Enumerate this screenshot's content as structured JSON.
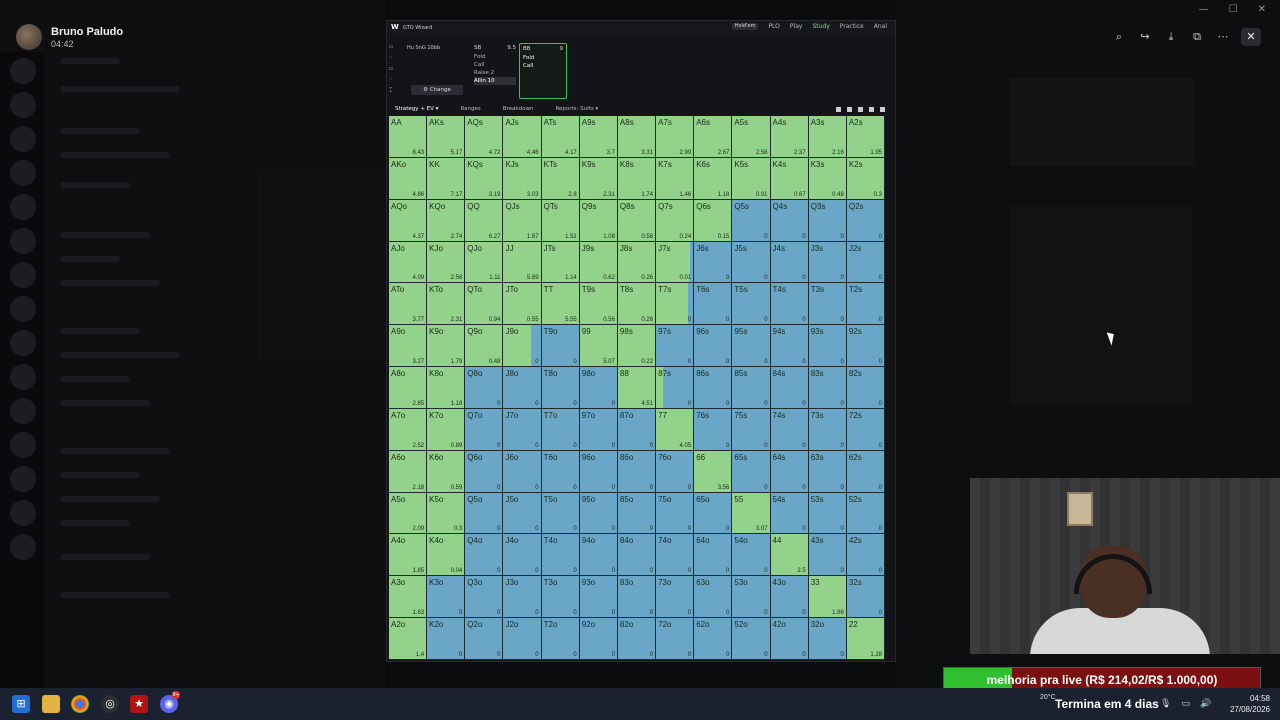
{
  "header": {
    "user_name": "Bruno Paludo",
    "time": "04:42"
  },
  "gto": {
    "logo": "W",
    "title": "GTO Wizard",
    "nav": [
      {
        "label": "Hold'em"
      },
      {
        "label": "PLO"
      },
      {
        "label": "Play"
      },
      {
        "label": "Study",
        "active": true
      },
      {
        "label": "Practice"
      },
      {
        "label": "Anal"
      }
    ],
    "game_format": "Hu SnG 10bb",
    "change_label": "Change",
    "col1": {
      "position": "SB",
      "stack": "9.5",
      "actions": [
        "Fold",
        "Call",
        "Raise 2",
        "Allin 10"
      ]
    },
    "col2": {
      "position": "BB",
      "stack": "9",
      "actions": [
        "Fold",
        "Call"
      ]
    },
    "subtabs": [
      "Strategy + EV",
      "Ranges",
      "Breakdown",
      "Reports: Suits"
    ],
    "colors": {
      "call": "#93d28a",
      "fold": "#6aa6c8"
    }
  },
  "grid": [
    [
      "AA",
      "8.43",
      1
    ],
    [
      "AKs",
      "5.17",
      1
    ],
    [
      "AQs",
      "4.72",
      1
    ],
    [
      "AJs",
      "4.46",
      1
    ],
    [
      "ATs",
      "4.17",
      1
    ],
    [
      "A9s",
      "3.7",
      1
    ],
    [
      "A8s",
      "3.31",
      1
    ],
    [
      "A7s",
      "2.99",
      1
    ],
    [
      "A6s",
      "2.67",
      1
    ],
    [
      "A5s",
      "2.58",
      1
    ],
    [
      "A4s",
      "2.37",
      1
    ],
    [
      "A3s",
      "2.16",
      1
    ],
    [
      "A2s",
      "1.95",
      1
    ],
    [
      "AKo",
      "4.86",
      1
    ],
    [
      "KK",
      "7.17",
      1
    ],
    [
      "KQs",
      "3.19",
      1
    ],
    [
      "KJs",
      "3.03",
      1
    ],
    [
      "KTs",
      "2.8",
      1
    ],
    [
      "K9s",
      "2.31",
      1
    ],
    [
      "K8s",
      "1.74",
      1
    ],
    [
      "K7s",
      "1.46",
      1
    ],
    [
      "K6s",
      "1.18",
      1
    ],
    [
      "K5s",
      "0.91",
      1
    ],
    [
      "K4s",
      "0.67",
      1
    ],
    [
      "K3s",
      "0.48",
      1
    ],
    [
      "K2s",
      "0.3",
      1
    ],
    [
      "AQo",
      "4.37",
      1
    ],
    [
      "KQo",
      "2.74",
      1
    ],
    [
      "QQ",
      "6.27",
      1
    ],
    [
      "QJs",
      "1.67",
      1
    ],
    [
      "QTs",
      "1.51",
      1
    ],
    [
      "Q9s",
      "1.08",
      1
    ],
    [
      "Q8s",
      "0.58",
      1
    ],
    [
      "Q7s",
      "0.24",
      1
    ],
    [
      "Q6s",
      "0.15",
      1
    ],
    [
      "Q5s",
      "0",
      0
    ],
    [
      "Q4s",
      "0",
      0
    ],
    [
      "Q3s",
      "0",
      0
    ],
    [
      "Q2s",
      "0",
      0
    ],
    [
      "AJo",
      "4.09",
      1
    ],
    [
      "KJo",
      "2.56",
      1
    ],
    [
      "QJo",
      "1.11",
      1
    ],
    [
      "JJ",
      "5.89",
      1
    ],
    [
      "JTs",
      "1.14",
      1
    ],
    [
      "J9s",
      "0.62",
      1
    ],
    [
      "J8s",
      "0.26",
      1
    ],
    [
      "J7s",
      "0.01",
      0.9
    ],
    [
      "J6s",
      "0",
      0
    ],
    [
      "J5s",
      "0",
      0
    ],
    [
      "J4s",
      "0",
      0
    ],
    [
      "J3s",
      "0",
      0
    ],
    [
      "J2s",
      "0",
      0
    ],
    [
      "ATo",
      "3.77",
      1
    ],
    [
      "KTo",
      "2.31",
      1
    ],
    [
      "QTo",
      "0.94",
      1
    ],
    [
      "JTo",
      "0.55",
      1
    ],
    [
      "TT",
      "5.55",
      1
    ],
    [
      "T9s",
      "0.56",
      1
    ],
    [
      "T8s",
      "0.26",
      1
    ],
    [
      "T7s",
      "0",
      0.85
    ],
    [
      "T6s",
      "0",
      0
    ],
    [
      "T5s",
      "0",
      0
    ],
    [
      "T4s",
      "0",
      0
    ],
    [
      "T3s",
      "0",
      0
    ],
    [
      "T2s",
      "0",
      0
    ],
    [
      "A9o",
      "3.27",
      1
    ],
    [
      "K9o",
      "1.79",
      1
    ],
    [
      "Q9o",
      "0.48",
      1
    ],
    [
      "J9o",
      "0",
      0.75
    ],
    [
      "T9o",
      "0",
      0
    ],
    [
      "99",
      "5.07",
      1
    ],
    [
      "98s",
      "0.22",
      1
    ],
    [
      "97s",
      "0",
      0
    ],
    [
      "96s",
      "0",
      0
    ],
    [
      "95s",
      "0",
      0
    ],
    [
      "94s",
      "0",
      0
    ],
    [
      "93s",
      "0",
      0
    ],
    [
      "92s",
      "0",
      0
    ],
    [
      "A8o",
      "2.85",
      1
    ],
    [
      "K8o",
      "1.18",
      1
    ],
    [
      "Q8o",
      "0",
      0
    ],
    [
      "J8o",
      "0",
      0
    ],
    [
      "T8o",
      "0",
      0
    ],
    [
      "98o",
      "0",
      0
    ],
    [
      "88",
      "4.51",
      1
    ],
    [
      "87s",
      "0",
      0.2
    ],
    [
      "86s",
      "0",
      0
    ],
    [
      "85s",
      "0",
      0
    ],
    [
      "84s",
      "0",
      0
    ],
    [
      "83s",
      "0",
      0
    ],
    [
      "82s",
      "0",
      0
    ],
    [
      "A7o",
      "2.52",
      1
    ],
    [
      "K7o",
      "0.89",
      1
    ],
    [
      "Q7o",
      "0",
      0
    ],
    [
      "J7o",
      "0",
      0
    ],
    [
      "T7o",
      "0",
      0
    ],
    [
      "97o",
      "0",
      0
    ],
    [
      "87o",
      "0",
      0
    ],
    [
      "77",
      "4.05",
      1
    ],
    [
      "76s",
      "0",
      0
    ],
    [
      "75s",
      "0",
      0
    ],
    [
      "74s",
      "0",
      0
    ],
    [
      "73s",
      "0",
      0
    ],
    [
      "72s",
      "0",
      0
    ],
    [
      "A6o",
      "2.18",
      1
    ],
    [
      "K6o",
      "0.59",
      1
    ],
    [
      "Q6o",
      "0",
      0
    ],
    [
      "J6o",
      "0",
      0
    ],
    [
      "T6o",
      "0",
      0
    ],
    [
      "96o",
      "0",
      0
    ],
    [
      "86o",
      "0",
      0
    ],
    [
      "76o",
      "0",
      0
    ],
    [
      "66",
      "3.56",
      1
    ],
    [
      "65s",
      "0",
      0
    ],
    [
      "64s",
      "0",
      0
    ],
    [
      "63s",
      "0",
      0
    ],
    [
      "62s",
      "0",
      0
    ],
    [
      "A5o",
      "2.09",
      1
    ],
    [
      "K5o",
      "0.3",
      1
    ],
    [
      "Q5o",
      "0",
      0
    ],
    [
      "J5o",
      "0",
      0
    ],
    [
      "T5o",
      "0",
      0
    ],
    [
      "95o",
      "0",
      0
    ],
    [
      "85o",
      "0",
      0
    ],
    [
      "75o",
      "0",
      0
    ],
    [
      "65o",
      "0",
      0
    ],
    [
      "55",
      "3.07",
      1
    ],
    [
      "54s",
      "0",
      0
    ],
    [
      "53s",
      "0",
      0
    ],
    [
      "52s",
      "0",
      0
    ],
    [
      "A4o",
      "1.85",
      1
    ],
    [
      "K4o",
      "0.04",
      1
    ],
    [
      "Q4o",
      "0",
      0
    ],
    [
      "J4o",
      "0",
      0
    ],
    [
      "T4o",
      "0",
      0
    ],
    [
      "94o",
      "0",
      0
    ],
    [
      "84o",
      "0",
      0
    ],
    [
      "74o",
      "0",
      0
    ],
    [
      "64o",
      "0",
      0
    ],
    [
      "54o",
      "0",
      0
    ],
    [
      "44",
      "2.5",
      1
    ],
    [
      "43s",
      "0",
      0
    ],
    [
      "42s",
      "0",
      0
    ],
    [
      "A3o",
      "1.63",
      1
    ],
    [
      "K3o",
      "0",
      0
    ],
    [
      "Q3o",
      "0",
      0
    ],
    [
      "J3o",
      "0",
      0
    ],
    [
      "T3o",
      "0",
      0
    ],
    [
      "93o",
      "0",
      0
    ],
    [
      "83o",
      "0",
      0
    ],
    [
      "73o",
      "0",
      0
    ],
    [
      "63o",
      "0",
      0
    ],
    [
      "53o",
      "0",
      0
    ],
    [
      "43o",
      "0",
      0
    ],
    [
      "33",
      "1.86",
      1
    ],
    [
      "32s",
      "0",
      0
    ],
    [
      "A2o",
      "1.4",
      1
    ],
    [
      "K2o",
      "0",
      0
    ],
    [
      "Q2o",
      "0",
      0
    ],
    [
      "J2o",
      "0",
      0
    ],
    [
      "T2o",
      "0",
      0
    ],
    [
      "92o",
      "0",
      0
    ],
    [
      "82o",
      "0",
      0
    ],
    [
      "72o",
      "0",
      0
    ],
    [
      "62o",
      "0",
      0
    ],
    [
      "52o",
      "0",
      0
    ],
    [
      "42o",
      "0",
      0
    ],
    [
      "32o",
      "0",
      0
    ],
    [
      "22",
      "1.28",
      1
    ]
  ],
  "donation": {
    "text": "melhoria pra live (R$ 214,02/R$ 1.000,00)",
    "progress": 0.214
  },
  "taskbar": {
    "weather": "20°C",
    "toast": "Termina em 4 dias",
    "clock_time": "04:58",
    "clock_date": "27/08/2026",
    "badge": "9+"
  }
}
